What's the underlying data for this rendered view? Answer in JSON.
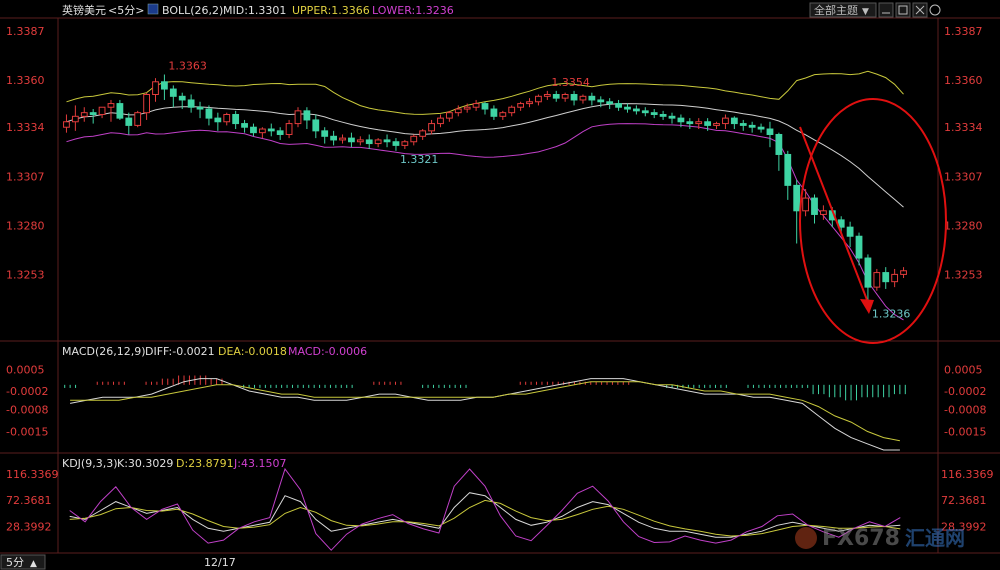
{
  "colors": {
    "up": "#e23c3c",
    "down": "#3fd4a4",
    "mid": "#cfcfcf",
    "upper": "#c8c83c",
    "lower": "#c040c8",
    "kline": "#d8d8d8",
    "dline": "#c8c83c",
    "jline": "#c040c8",
    "axis_text": "#e23c3c",
    "header_white": "#e0e0e0",
    "header_yellow": "#e0d040",
    "header_magenta": "#d040d0",
    "grid": "#3a1a1a",
    "annotation": "#e01010",
    "annotation_label_down": "#6ec8c8"
  },
  "header": {
    "symbol": "英镑美元",
    "period": "<5分>",
    "boll_label": "BOLL(26,2)",
    "mid_label": "MID:1.3301",
    "upper_label": "UPPER:1.3366",
    "lower_label": "LOWER:1.3236",
    "theme_button": "全部主题",
    "theme_arrow": "▼"
  },
  "macd_header": {
    "name": "MACD(26,12,9)",
    "diff": "DIFF:-0.0021",
    "dea": "DEA:-0.0018",
    "macd": "MACD:-0.0006"
  },
  "kdj_header": {
    "name": "KDJ(9,3,3)",
    "k": "K:30.3029",
    "d": "D:23.8791",
    "j": "J:43.1507"
  },
  "footer": {
    "period_button": "5分",
    "period_arrow": "▲",
    "date_tick": "12/17"
  },
  "watermark": {
    "brand": "FX678",
    "cn": "汇通网"
  },
  "chart_data": [
    {
      "type": "candlestick",
      "title": "英镑美元<5分>",
      "y_ticks": [
        "1.3387",
        "1.3360",
        "1.3334",
        "1.3307",
        "1.3280",
        "1.3253"
      ],
      "ylim": [
        1.3218,
        1.3393
      ],
      "x_tick": "12/17",
      "annotations": [
        "1.3363",
        "1.3354",
        "1.3321",
        "1.3236"
      ],
      "candles": [
        [
          1.3334,
          1.3341,
          1.3337,
          1.3331
        ],
        [
          1.3337,
          1.3346,
          1.334,
          1.3332
        ],
        [
          1.334,
          1.3345,
          1.3342,
          1.3337
        ],
        [
          1.3342,
          1.3344,
          1.3341,
          1.3336
        ],
        [
          1.3341,
          1.3345,
          1.3345,
          1.3339
        ],
        [
          1.3345,
          1.3349,
          1.3347,
          1.3337
        ],
        [
          1.3347,
          1.3349,
          1.3339,
          1.3338
        ],
        [
          1.3339,
          1.3342,
          1.3335,
          1.333
        ],
        [
          1.3335,
          1.3343,
          1.3342,
          1.3334
        ],
        [
          1.3342,
          1.3353,
          1.3352,
          1.3338
        ],
        [
          1.3352,
          1.3361,
          1.3359,
          1.3348
        ],
        [
          1.3359,
          1.3363,
          1.3355,
          1.3349
        ],
        [
          1.3355,
          1.3357,
          1.3351,
          1.3345
        ],
        [
          1.3351,
          1.3353,
          1.3349,
          1.3344
        ],
        [
          1.3349,
          1.3352,
          1.3345,
          1.3342
        ],
        [
          1.3345,
          1.3348,
          1.3344,
          1.3339
        ],
        [
          1.3344,
          1.3346,
          1.3339,
          1.3335
        ],
        [
          1.3339,
          1.3342,
          1.3337,
          1.3332
        ],
        [
          1.3337,
          1.3342,
          1.3341,
          1.3335
        ],
        [
          1.3341,
          1.3343,
          1.3336,
          1.3333
        ],
        [
          1.3336,
          1.3338,
          1.3334,
          1.3331
        ],
        [
          1.3334,
          1.3336,
          1.3331,
          1.3329
        ],
        [
          1.3331,
          1.3334,
          1.3333,
          1.3328
        ],
        [
          1.3333,
          1.3336,
          1.3332,
          1.3329
        ],
        [
          1.3332,
          1.3334,
          1.333,
          1.3327
        ],
        [
          1.333,
          1.3338,
          1.3336,
          1.3328
        ],
        [
          1.3336,
          1.3345,
          1.3343,
          1.3334
        ],
        [
          1.3343,
          1.3345,
          1.3338,
          1.3333
        ],
        [
          1.3338,
          1.3341,
          1.3332,
          1.3328
        ],
        [
          1.3332,
          1.3334,
          1.3329,
          1.3325
        ],
        [
          1.3329,
          1.3332,
          1.3327,
          1.3324
        ],
        [
          1.3327,
          1.333,
          1.3328,
          1.3325
        ],
        [
          1.3328,
          1.3331,
          1.3326,
          1.3323
        ],
        [
          1.3326,
          1.3329,
          1.3327,
          1.3324
        ],
        [
          1.3327,
          1.333,
          1.3325,
          1.3322
        ],
        [
          1.3325,
          1.3328,
          1.3327,
          1.3323
        ],
        [
          1.3327,
          1.333,
          1.3326,
          1.3323
        ],
        [
          1.3326,
          1.3328,
          1.3324,
          1.3321
        ],
        [
          1.3324,
          1.3327,
          1.3326,
          1.3322
        ],
        [
          1.3326,
          1.333,
          1.3329,
          1.3324
        ],
        [
          1.3329,
          1.3333,
          1.3332,
          1.3327
        ],
        [
          1.3332,
          1.3338,
          1.3336,
          1.333
        ],
        [
          1.3336,
          1.3341,
          1.3339,
          1.3334
        ],
        [
          1.3339,
          1.3343,
          1.3342,
          1.3337
        ],
        [
          1.3342,
          1.3346,
          1.3344,
          1.334
        ],
        [
          1.3344,
          1.3347,
          1.3345,
          1.3342
        ],
        [
          1.3345,
          1.3349,
          1.3347,
          1.3343
        ],
        [
          1.3347,
          1.3348,
          1.3344,
          1.3341
        ],
        [
          1.3344,
          1.3346,
          1.334,
          1.3338
        ],
        [
          1.334,
          1.3343,
          1.3342,
          1.3338
        ],
        [
          1.3342,
          1.3346,
          1.3345,
          1.334
        ],
        [
          1.3345,
          1.3348,
          1.3347,
          1.3343
        ],
        [
          1.3347,
          1.335,
          1.3348,
          1.3345
        ],
        [
          1.3348,
          1.3352,
          1.3351,
          1.3346
        ],
        [
          1.3351,
          1.3354,
          1.3352,
          1.3349
        ],
        [
          1.3352,
          1.3354,
          1.335,
          1.3348
        ],
        [
          1.335,
          1.3353,
          1.3352,
          1.3348
        ],
        [
          1.3352,
          1.3354,
          1.3349,
          1.3346
        ],
        [
          1.3349,
          1.3352,
          1.3351,
          1.3347
        ],
        [
          1.3351,
          1.3353,
          1.3349,
          1.3346
        ],
        [
          1.3349,
          1.3351,
          1.3348,
          1.3345
        ],
        [
          1.3348,
          1.335,
          1.3347,
          1.3344
        ],
        [
          1.3347,
          1.3349,
          1.3345,
          1.3343
        ],
        [
          1.3345,
          1.3347,
          1.3344,
          1.3342
        ],
        [
          1.3344,
          1.3346,
          1.3343,
          1.3341
        ],
        [
          1.3343,
          1.3345,
          1.3342,
          1.334
        ],
        [
          1.3342,
          1.3344,
          1.3341,
          1.3339
        ],
        [
          1.3341,
          1.3343,
          1.334,
          1.3338
        ],
        [
          1.334,
          1.3342,
          1.3339,
          1.3336
        ],
        [
          1.3339,
          1.3341,
          1.3337,
          1.3334
        ],
        [
          1.3337,
          1.3339,
          1.3336,
          1.3333
        ],
        [
          1.3336,
          1.3339,
          1.3337,
          1.3333
        ],
        [
          1.3337,
          1.3339,
          1.3335,
          1.3332
        ],
        [
          1.3335,
          1.3337,
          1.3336,
          1.3333
        ],
        [
          1.3336,
          1.3341,
          1.3339,
          1.3333
        ],
        [
          1.3339,
          1.334,
          1.3336,
          1.3333
        ],
        [
          1.3336,
          1.3338,
          1.3335,
          1.3332
        ],
        [
          1.3335,
          1.3337,
          1.3334,
          1.3331
        ],
        [
          1.3334,
          1.3336,
          1.3333,
          1.3331
        ],
        [
          1.3333,
          1.3337,
          1.333,
          1.3323
        ],
        [
          1.333,
          1.3331,
          1.3319,
          1.331
        ],
        [
          1.3319,
          1.3321,
          1.3302,
          1.3294
        ],
        [
          1.3302,
          1.3305,
          1.3288,
          1.327
        ],
        [
          1.3288,
          1.33,
          1.3295,
          1.3285
        ],
        [
          1.3295,
          1.3297,
          1.3286,
          1.3281
        ],
        [
          1.3286,
          1.3291,
          1.3288,
          1.3283
        ],
        [
          1.3288,
          1.329,
          1.3283,
          1.3279
        ],
        [
          1.3283,
          1.3285,
          1.3279,
          1.3276
        ],
        [
          1.3279,
          1.3282,
          1.3274,
          1.3268
        ],
        [
          1.3274,
          1.3276,
          1.3262,
          1.3258
        ],
        [
          1.3262,
          1.3264,
          1.3246,
          1.3236
        ],
        [
          1.3246,
          1.3256,
          1.3254,
          1.3244
        ],
        [
          1.3254,
          1.3257,
          1.3249,
          1.3245
        ],
        [
          1.3249,
          1.3256,
          1.3253,
          1.3246
        ],
        [
          1.3253,
          1.3257,
          1.3255,
          1.3251
        ]
      ]
    },
    {
      "type": "line",
      "title": "MACD(26,12,9)",
      "y_ticks": [
        "0.0005",
        "-0.0002",
        "-0.0008",
        "-0.0015"
      ],
      "ylim": [
        -0.0021,
        0.0008
      ],
      "series": [
        {
          "name": "DIFF",
          "values": [
            -0.0006,
            -0.0005,
            -0.0004,
            -0.0004,
            -0.0004,
            -0.0003,
            -0.0001,
            0.0001,
            0.0002,
            0.0002,
            0.0,
            -0.0002,
            -0.0003,
            -0.0004,
            -0.0004,
            -0.0005,
            -0.0005,
            -0.0005,
            -0.0004,
            -0.0003,
            -0.0003,
            -0.0004,
            -0.0005,
            -0.0005,
            -0.0005,
            -0.0004,
            -0.0004,
            -0.0003,
            -0.0002,
            -0.0001,
            0.0,
            0.0001,
            0.0002,
            0.0002,
            0.0002,
            0.0001,
            0.0,
            -0.0001,
            -0.0002,
            -0.0003,
            -0.0003,
            -0.0003,
            -0.0004,
            -0.0004,
            -0.0005,
            -0.0006,
            -0.001,
            -0.0014,
            -0.0017,
            -0.0019,
            -0.0021,
            -0.0021
          ]
        },
        {
          "name": "DEA",
          "values": [
            -0.0005,
            -0.0005,
            -0.0005,
            -0.0005,
            -0.0004,
            -0.0004,
            -0.0003,
            -0.0002,
            -0.0001,
            0.0,
            0.0,
            -0.0001,
            -0.0002,
            -0.0003,
            -0.0003,
            -0.0004,
            -0.0004,
            -0.0004,
            -0.0004,
            -0.0004,
            -0.0004,
            -0.0004,
            -0.0004,
            -0.0004,
            -0.0004,
            -0.0004,
            -0.0004,
            -0.0003,
            -0.0003,
            -0.0002,
            -0.0001,
            0.0,
            0.0001,
            0.0001,
            0.0001,
            0.0001,
            0.0,
            0.0,
            -0.0001,
            -0.0002,
            -0.0002,
            -0.0003,
            -0.0003,
            -0.0003,
            -0.0004,
            -0.0005,
            -0.0007,
            -0.001,
            -0.0012,
            -0.0015,
            -0.0017,
            -0.0018
          ]
        },
        {
          "name": "MACD",
          "values": [
            -0.0001,
            0.0,
            0.0001,
            0.0001,
            0.0,
            0.0001,
            0.0002,
            0.0003,
            0.0003,
            0.0002,
            0.0,
            -0.0001,
            -0.0001,
            -0.0001,
            -0.0001,
            -0.0001,
            -0.0001,
            -0.0001,
            0.0,
            0.0001,
            0.0001,
            0.0,
            -0.0001,
            -0.0001,
            -0.0001,
            0.0,
            0.0,
            0.0,
            0.0001,
            0.0001,
            0.0001,
            0.0001,
            0.0001,
            0.0001,
            0.0001,
            0.0,
            0.0,
            -0.0001,
            -0.0001,
            -0.0001,
            -0.0001,
            0.0,
            -0.0001,
            -0.0001,
            -0.0001,
            -0.0001,
            -0.0003,
            -0.0004,
            -0.0005,
            -0.0004,
            -0.0004,
            -0.0003
          ]
        }
      ]
    },
    {
      "type": "line",
      "title": "KDJ(9,3,3)",
      "y_ticks": [
        "116.3369",
        "72.3681",
        "28.3992"
      ],
      "ylim": [
        -15,
        130
      ],
      "series": [
        {
          "name": "K",
          "values": [
            45,
            40,
            55,
            70,
            60,
            50,
            55,
            60,
            40,
            25,
            20,
            25,
            30,
            35,
            80,
            70,
            40,
            20,
            25,
            30,
            35,
            40,
            35,
            30,
            25,
            60,
            85,
            80,
            60,
            40,
            30,
            35,
            45,
            60,
            70,
            65,
            50,
            35,
            25,
            20,
            20,
            15,
            10,
            10,
            15,
            20,
            30,
            35,
            30,
            25,
            20,
            25,
            30,
            28,
            30
          ]
        },
        {
          "name": "D",
          "values": [
            40,
            42,
            48,
            58,
            60,
            55,
            54,
            57,
            49,
            38,
            28,
            25,
            27,
            31,
            50,
            60,
            52,
            38,
            30,
            29,
            32,
            36,
            36,
            33,
            29,
            42,
            60,
            72,
            67,
            54,
            43,
            38,
            40,
            48,
            57,
            62,
            57,
            47,
            37,
            29,
            24,
            20,
            15,
            12,
            13,
            16,
            22,
            28,
            30,
            28,
            25,
            25,
            27,
            28,
            24
          ]
        },
        {
          "name": "J",
          "values": [
            55,
            36,
            70,
            95,
            60,
            40,
            57,
            66,
            22,
            0,
            5,
            25,
            36,
            43,
            140,
            90,
            16,
            -15,
            15,
            32,
            41,
            48,
            33,
            24,
            17,
            96,
            135,
            96,
            46,
            12,
            4,
            29,
            55,
            84,
            96,
            71,
            36,
            11,
            1,
            2,
            12,
            5,
            0,
            5,
            19,
            28,
            46,
            49,
            30,
            19,
            10,
            25,
            36,
            28,
            43
          ]
        }
      ]
    }
  ]
}
